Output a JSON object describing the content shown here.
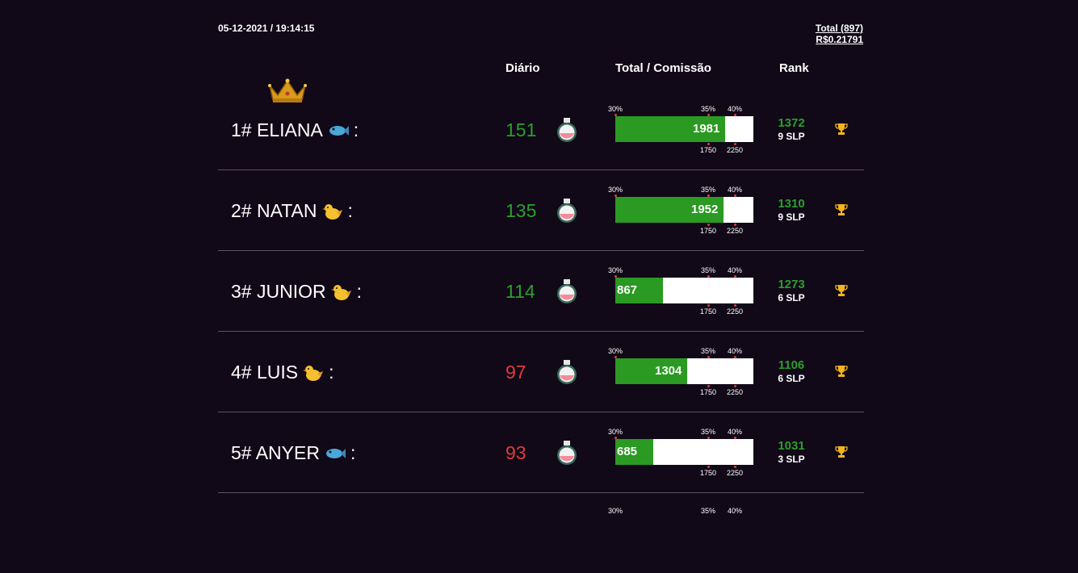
{
  "header": {
    "timestamp": "05-12-2021 / 19:14:15",
    "total": "Total (897)",
    "rate": "R$0.21791",
    "col_daily": "Diário",
    "col_total": "Total / Comissão",
    "col_rank": "Rank"
  },
  "bar_labels": {
    "p30": "30%",
    "p35": "35%",
    "p40": "40%",
    "m1750": "1750",
    "m2250": "2250"
  },
  "rows": [
    {
      "name": "1# ELIANA",
      "pet": "fish-icon",
      "suffix": ":",
      "daily": "151",
      "daily_status": "good",
      "total": "1981",
      "total_value": 1981,
      "rank": "1372",
      "slp": "9 SLP"
    },
    {
      "name": "2# NATAN",
      "pet": "chick-icon",
      "suffix": ":",
      "daily": "135",
      "daily_status": "good",
      "total": "1952",
      "total_value": 1952,
      "rank": "1310",
      "slp": "9 SLP"
    },
    {
      "name": "3# JUNIOR",
      "pet": "chick-icon",
      "suffix": ":",
      "daily": "114",
      "daily_status": "good",
      "total": "867",
      "total_value": 867,
      "rank": "1273",
      "slp": "6 SLP"
    },
    {
      "name": "4# LUIS",
      "pet": "chick-icon",
      "suffix": ":",
      "daily": "97",
      "daily_status": "bad",
      "total": "1304",
      "total_value": 1304,
      "rank": "1106",
      "slp": "6 SLP"
    },
    {
      "name": "5# ANYER",
      "pet": "fish-icon",
      "suffix": ":",
      "daily": "93",
      "daily_status": "bad",
      "total": "685",
      "total_value": 685,
      "rank": "1031",
      "slp": "3 SLP"
    }
  ],
  "colors": {
    "good": "#2aa02a",
    "bad": "#e23b3b",
    "bar": "#2a9a22",
    "background": "#110818"
  }
}
